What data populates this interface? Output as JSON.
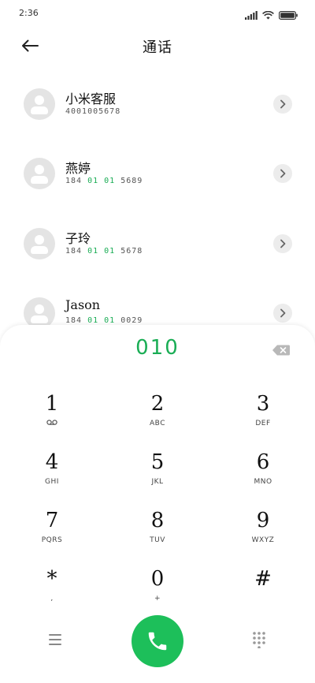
{
  "status_bar": {
    "time": "2:36"
  },
  "header": {
    "title": "通话"
  },
  "contacts": [
    {
      "name": "小米客服",
      "number_pre": "4001",
      "number_hl": "",
      "number_post": "005678"
    },
    {
      "name": "燕婷",
      "number_pre": "184 ",
      "number_hl": "01 01",
      "number_post": " 5689"
    },
    {
      "name": "子玲",
      "number_pre": "184 ",
      "number_hl": "01 01",
      "number_post": " 5678"
    },
    {
      "name": "Jason",
      "number_pre": "184 ",
      "number_hl": "01 01",
      "number_post": " 0029"
    }
  ],
  "dialer": {
    "input": "010",
    "keys": [
      {
        "digit": "1",
        "letters": ""
      },
      {
        "digit": "2",
        "letters": "ABC"
      },
      {
        "digit": "3",
        "letters": "DEF"
      },
      {
        "digit": "4",
        "letters": "GHI"
      },
      {
        "digit": "5",
        "letters": "JKL"
      },
      {
        "digit": "6",
        "letters": "MNO"
      },
      {
        "digit": "7",
        "letters": "PQRS"
      },
      {
        "digit": "8",
        "letters": "TUV"
      },
      {
        "digit": "9",
        "letters": "WXYZ"
      },
      {
        "digit": "*",
        "letters": ","
      },
      {
        "digit": "0",
        "letters": "+"
      },
      {
        "digit": "#",
        "letters": ""
      }
    ]
  },
  "colors": {
    "accent": "#1aad55",
    "call_button": "#1dbf5a"
  },
  "icons": [
    "back-arrow-icon",
    "signal-icon",
    "wifi-icon",
    "battery-icon",
    "chevron-right-icon",
    "backspace-icon",
    "voicemail-icon",
    "menu-icon",
    "phone-icon",
    "dialpad-icon"
  ]
}
